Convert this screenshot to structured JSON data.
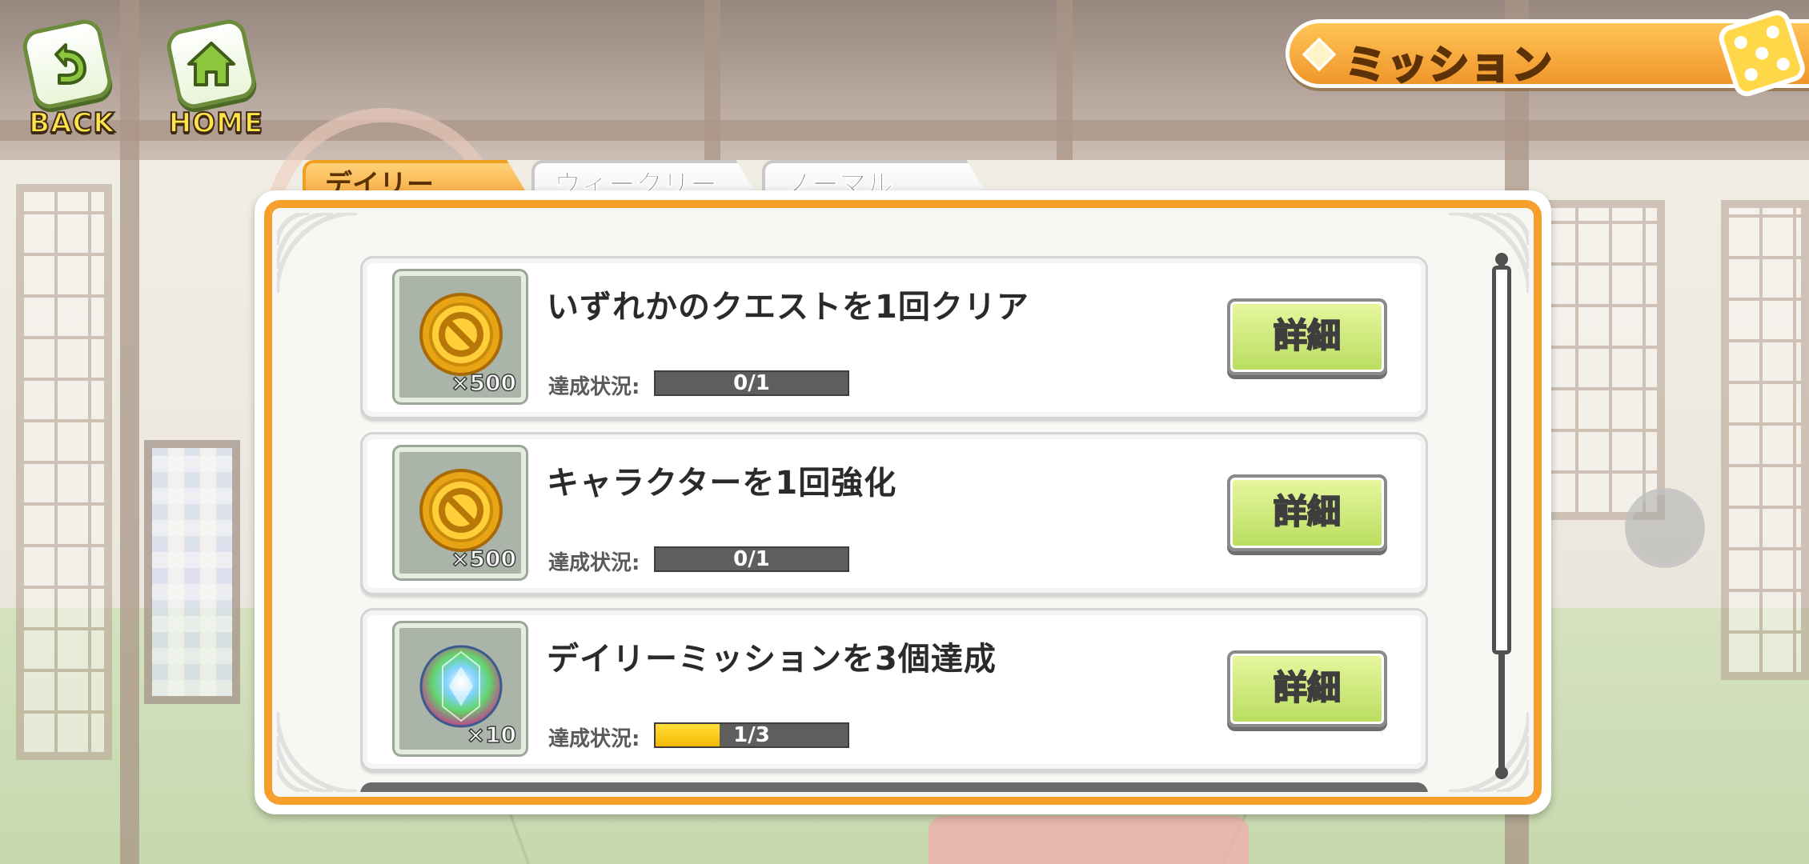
{
  "nav": {
    "back_label": "BACK",
    "home_label": "HOME"
  },
  "header": {
    "title": "ミッション"
  },
  "tabs": [
    {
      "label": "デイリー",
      "active": true
    },
    {
      "label": "ウィークリー",
      "active": false
    },
    {
      "label": "ノーマル",
      "active": false
    }
  ],
  "missions": [
    {
      "title": "いずれかのクエストを1回クリア",
      "reward_icon": "gold-coin-icon",
      "reward_qty": "×500",
      "progress_label": "達成状況:",
      "progress_text": "0/1",
      "progress_value": 0,
      "detail_label": "詳細"
    },
    {
      "title": "キャラクターを1回強化",
      "reward_icon": "gold-coin-icon",
      "reward_qty": "×500",
      "progress_label": "達成状況:",
      "progress_text": "0/1",
      "progress_value": 0,
      "detail_label": "詳細"
    },
    {
      "title": "デイリーミッションを3個達成",
      "reward_icon": "rainbow-gem-icon",
      "reward_qty": "×10",
      "progress_label": "達成状況:",
      "progress_text": "1/3",
      "progress_value": 0.333,
      "detail_label": "詳細"
    }
  ],
  "colors": {
    "accent_orange": "#f5a02a",
    "button_green": "#b8dd5e",
    "progress_yellow": "#f5b800"
  }
}
